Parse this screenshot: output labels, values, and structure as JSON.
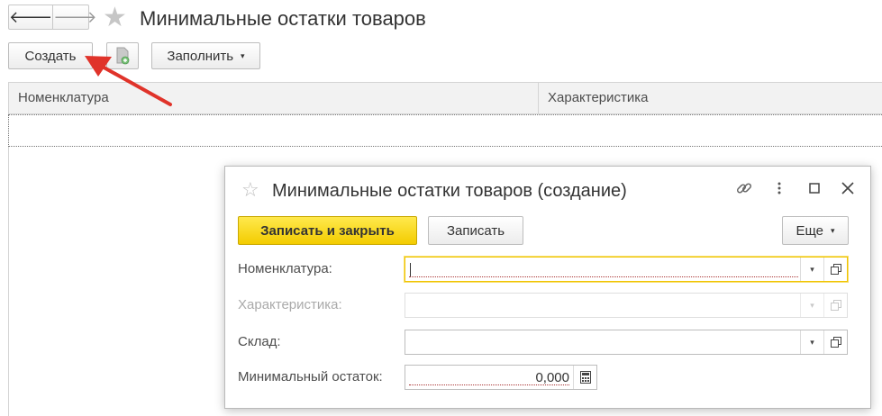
{
  "nav": {
    "back_icon": "arrow-left-icon",
    "forward_icon": "arrow-right-icon",
    "back_glyph": "🡐",
    "forward_glyph": "🡒"
  },
  "page": {
    "title": "Минимальные остатки товаров",
    "star_glyph": "★"
  },
  "toolbar": {
    "create_label": "Создать",
    "fill_label": "Заполнить",
    "caret": "▾"
  },
  "table": {
    "columns": [
      "Номенклатура",
      "Характеристика"
    ]
  },
  "dialog": {
    "title": "Минимальные остатки товаров (создание)",
    "star_glyph": "☆",
    "save_close_label": "Записать и закрыть",
    "save_label": "Записать",
    "more_label": "Еще",
    "fields": {
      "nomenclature_label": "Номенклатура:",
      "characteristic_label": "Характеристика:",
      "warehouse_label": "Склад:",
      "min_stock_label": "Минимальный остаток:",
      "min_stock_value": "0,000"
    }
  },
  "colors": {
    "accent_yellow": "#f3cc00",
    "arrow_red": "#e0332a"
  }
}
